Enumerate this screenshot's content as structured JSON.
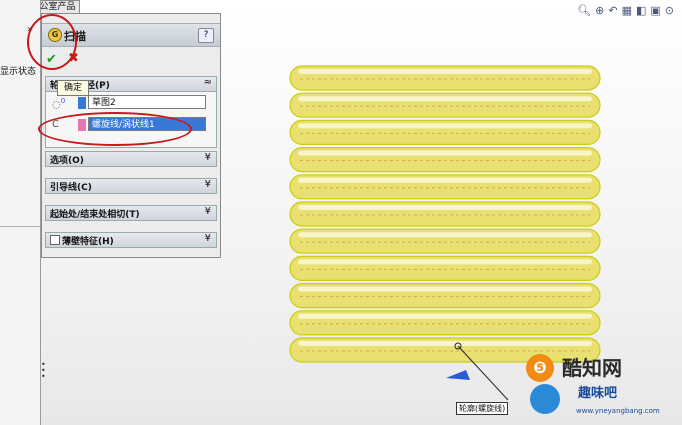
{
  "tabs": [
    "pert",
    "办公室产品"
  ],
  "left_pane": {
    "status_text": "显示状态",
    "chevron": "»"
  },
  "feature": {
    "title": "扫描",
    "help": "?",
    "ok_tooltip": "确定",
    "ok_icon": "check-icon",
    "cancel_icon": "x-icon"
  },
  "path_section": {
    "label": "轮廓和路径(P)",
    "profile_selection": "草图2",
    "path_selection": "螺旋线/涡状线1",
    "profile_index": "0",
    "path_index": "C"
  },
  "sections": [
    {
      "label": "选项(O)",
      "has_checkbox": false
    },
    {
      "label": "引导线(C)",
      "has_checkbox": false
    },
    {
      "label": "起始处/结束处相切(T)",
      "has_checkbox": false
    },
    {
      "label": "薄壁特征(H)",
      "has_checkbox": true
    }
  ],
  "viewport": {
    "callout": "轮廓(螺旋线)",
    "spring_coils": 11,
    "spring_color": "#e8e070",
    "spring_outline": "#cccc10"
  },
  "watermark": {
    "main": "酷知网",
    "sub": "趣味吧",
    "url": "www.yneyangbang.com"
  },
  "colors": {
    "annotation_red": "#c81818",
    "selection_blue": "#3a78d8",
    "ok_green": "#1a9a1a",
    "cancel_red": "#cc1a1a"
  }
}
